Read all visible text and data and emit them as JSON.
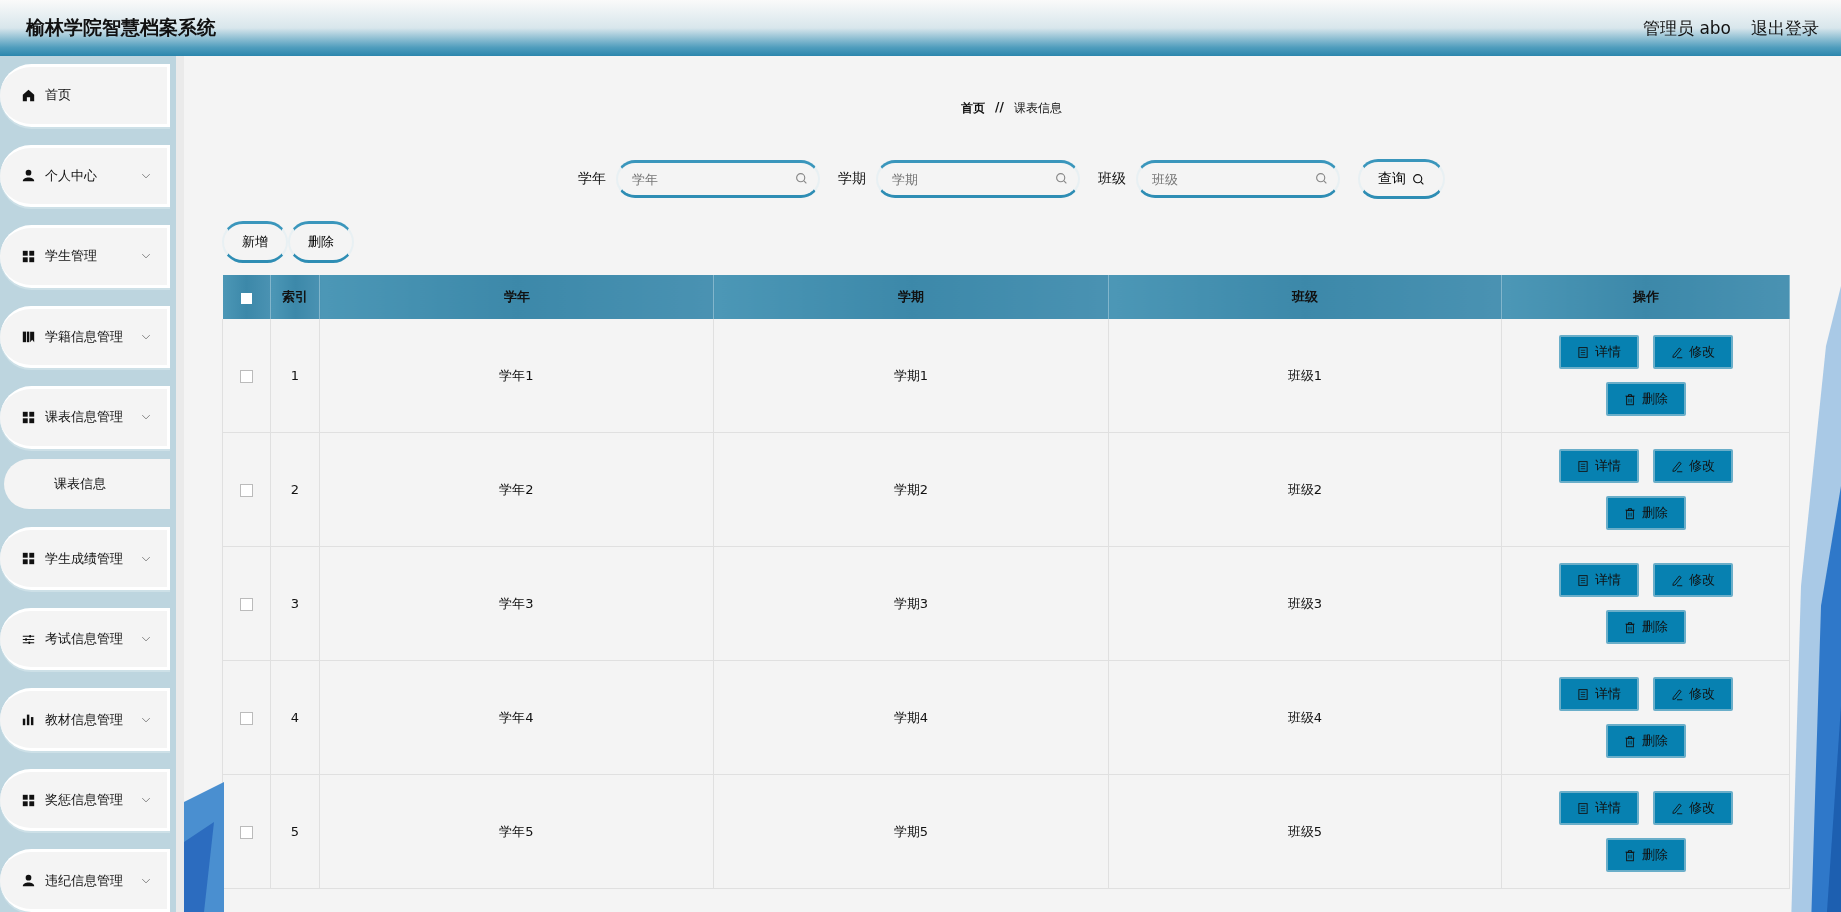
{
  "header": {
    "title": "榆林学院智慧档案系统",
    "user": "管理员 abo",
    "logout": "退出登录"
  },
  "sidebar": {
    "items": [
      {
        "label": "首页",
        "expandable": false
      },
      {
        "label": "个人中心",
        "expandable": true
      },
      {
        "label": "学生管理",
        "expandable": true
      },
      {
        "label": "学籍信息管理",
        "expandable": true
      },
      {
        "label": "课表信息管理",
        "expandable": true,
        "children": [
          {
            "label": "课表信息"
          }
        ]
      },
      {
        "label": "学生成绩管理",
        "expandable": true
      },
      {
        "label": "考试信息管理",
        "expandable": true
      },
      {
        "label": "教材信息管理",
        "expandable": true
      },
      {
        "label": "奖惩信息管理",
        "expandable": true
      },
      {
        "label": "违纪信息管理",
        "expandable": true
      }
    ]
  },
  "breadcrumb": {
    "home": "首页",
    "separator": "//",
    "current": "课表信息"
  },
  "search": {
    "fields": [
      {
        "label": "学年",
        "placeholder": "学年"
      },
      {
        "label": "学期",
        "placeholder": "学期"
      },
      {
        "label": "班级",
        "placeholder": "班级"
      }
    ],
    "button": "查询"
  },
  "actions": [
    "新增",
    "删除"
  ],
  "table": {
    "all_checked": false,
    "columns": [
      "索引",
      "学年",
      "学期",
      "班级",
      "操作"
    ],
    "rows": [
      {
        "checked": false,
        "cells": [
          "1",
          "学年1",
          "学期1",
          "班级1"
        ],
        "buttons": [
          {
            "kind": "detail",
            "label": "详情"
          },
          {
            "kind": "edit",
            "label": "修改"
          },
          {
            "kind": "delete",
            "label": "删除"
          }
        ]
      },
      {
        "checked": false,
        "cells": [
          "2",
          "学年2",
          "学期2",
          "班级2"
        ],
        "buttons": [
          {
            "kind": "detail",
            "label": "详情"
          },
          {
            "kind": "edit",
            "label": "修改"
          },
          {
            "kind": "delete",
            "label": "删除"
          }
        ]
      },
      {
        "checked": false,
        "cells": [
          "3",
          "学年3",
          "学期3",
          "班级3"
        ],
        "buttons": [
          {
            "kind": "detail",
            "label": "详情"
          },
          {
            "kind": "edit",
            "label": "修改"
          },
          {
            "kind": "delete",
            "label": "删除"
          }
        ]
      },
      {
        "checked": false,
        "cells": [
          "4",
          "学年4",
          "学期4",
          "班级4"
        ],
        "buttons": [
          {
            "kind": "detail",
            "label": "详情"
          },
          {
            "kind": "edit",
            "label": "修改"
          },
          {
            "kind": "delete",
            "label": "删除"
          }
        ]
      },
      {
        "checked": false,
        "cells": [
          "5",
          "学年5",
          "学期5",
          "班级5"
        ],
        "buttons": [
          {
            "kind": "detail",
            "label": "详情"
          },
          {
            "kind": "edit",
            "label": "修改"
          },
          {
            "kind": "delete",
            "label": "删除"
          }
        ]
      }
    ]
  }
}
